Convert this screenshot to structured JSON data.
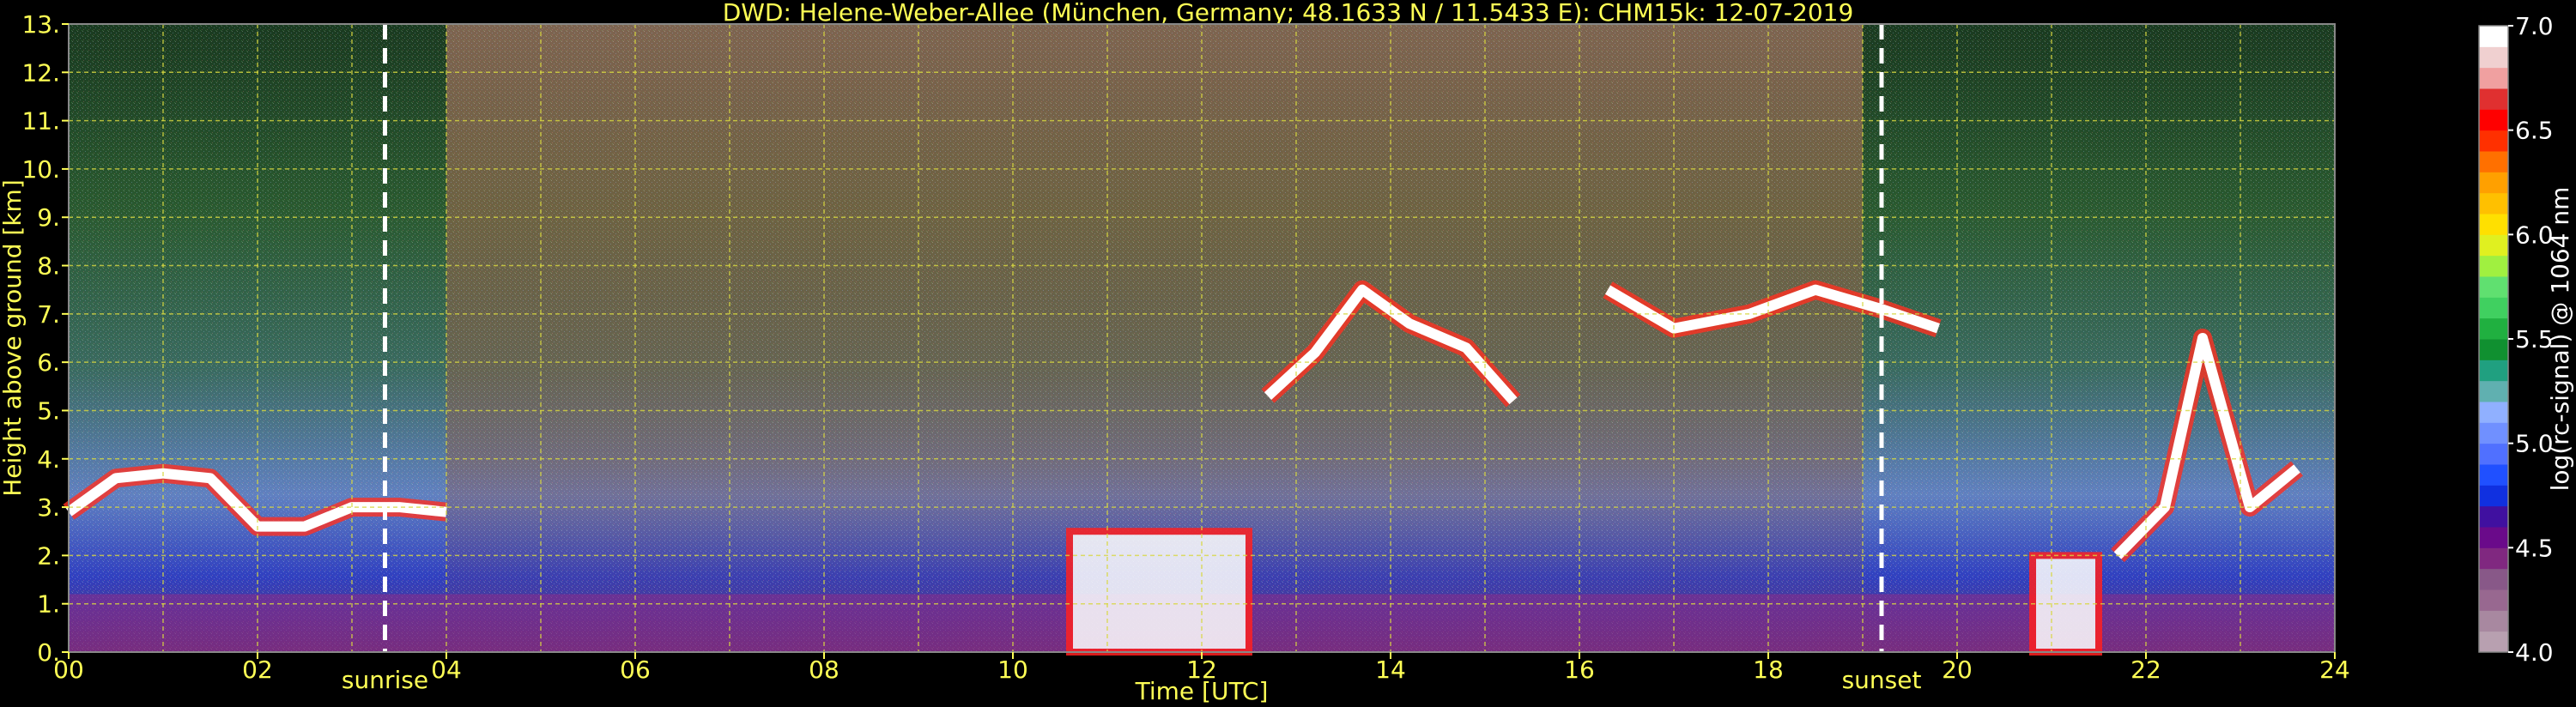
{
  "chart_data": {
    "type": "heatmap",
    "title": "DWD: Helene-Weber-Allee (München, Germany; 48.1633 N / 11.5433 E):    CHM15k: 12-07-2019",
    "xlabel": "Time [UTC]",
    "ylabel": "Height above ground [km]",
    "xlim": [
      0,
      24
    ],
    "ylim": [
      0,
      13
    ],
    "x_ticks": [
      "00",
      "02",
      "04",
      "06",
      "08",
      "10",
      "12",
      "14",
      "16",
      "18",
      "20",
      "22",
      "24"
    ],
    "y_ticks": [
      "0.",
      "1.",
      "2.",
      "3.",
      "4.",
      "5.",
      "6.",
      "7.",
      "8.",
      "9.",
      "10.",
      "11.",
      "12.",
      "13."
    ],
    "grid": true,
    "annotations": [
      {
        "label": "sunrise",
        "x": 3.35
      },
      {
        "label": "sunset",
        "x": 19.2
      }
    ],
    "colorbar": {
      "label": "log(rc-signal) @ 1064 nm",
      "range": [
        4.0,
        7.0
      ],
      "ticks": [
        "4.0",
        "4.5",
        "5.0",
        "5.5",
        "6.0",
        "6.5",
        "7.0"
      ],
      "colors": [
        "#b8a0b0",
        "#a888a0",
        "#986890",
        "#885888",
        "#802880",
        "#6a0a8a",
        "#4010a0",
        "#1030e0",
        "#2050ff",
        "#5070ff",
        "#7090ff",
        "#90b0ff",
        "#60b0b0",
        "#20a080",
        "#109030",
        "#20b040",
        "#40d060",
        "#60e070",
        "#a0f040",
        "#e0f020",
        "#ffe000",
        "#ffc000",
        "#ffa000",
        "#ff7000",
        "#ff3000",
        "#ff0000",
        "#e03030",
        "#f0a0a0",
        "#f0d0d0",
        "#ffffff"
      ]
    },
    "cloud_layers": [
      {
        "x": [
          0.0,
          0.5,
          1.0,
          1.5,
          2.0,
          2.5,
          3.0,
          3.5,
          4.0
        ],
        "y": [
          2.9,
          3.6,
          3.7,
          3.6,
          2.6,
          2.6,
          3.0,
          3.0,
          2.9
        ]
      },
      {
        "x": [
          12.7,
          13.2,
          13.7,
          14.2,
          14.8,
          15.3
        ],
        "y": [
          5.3,
          6.2,
          7.5,
          6.8,
          6.3,
          5.2
        ]
      },
      {
        "x": [
          16.3,
          17.0,
          17.8,
          18.5,
          19.2,
          19.8
        ],
        "y": [
          7.5,
          6.7,
          7.0,
          7.5,
          7.1,
          6.7
        ]
      },
      {
        "x": [
          21.7,
          22.2,
          22.6,
          23.1,
          23.6
        ],
        "y": [
          2.0,
          3.0,
          6.5,
          3.0,
          3.8
        ]
      }
    ],
    "dense_regions": [
      {
        "x": [
          10.6,
          12.5
        ],
        "y": [
          0.0,
          2.5
        ]
      },
      {
        "x": [
          20.8,
          21.5
        ],
        "y": [
          0.0,
          2.0
        ]
      }
    ]
  }
}
